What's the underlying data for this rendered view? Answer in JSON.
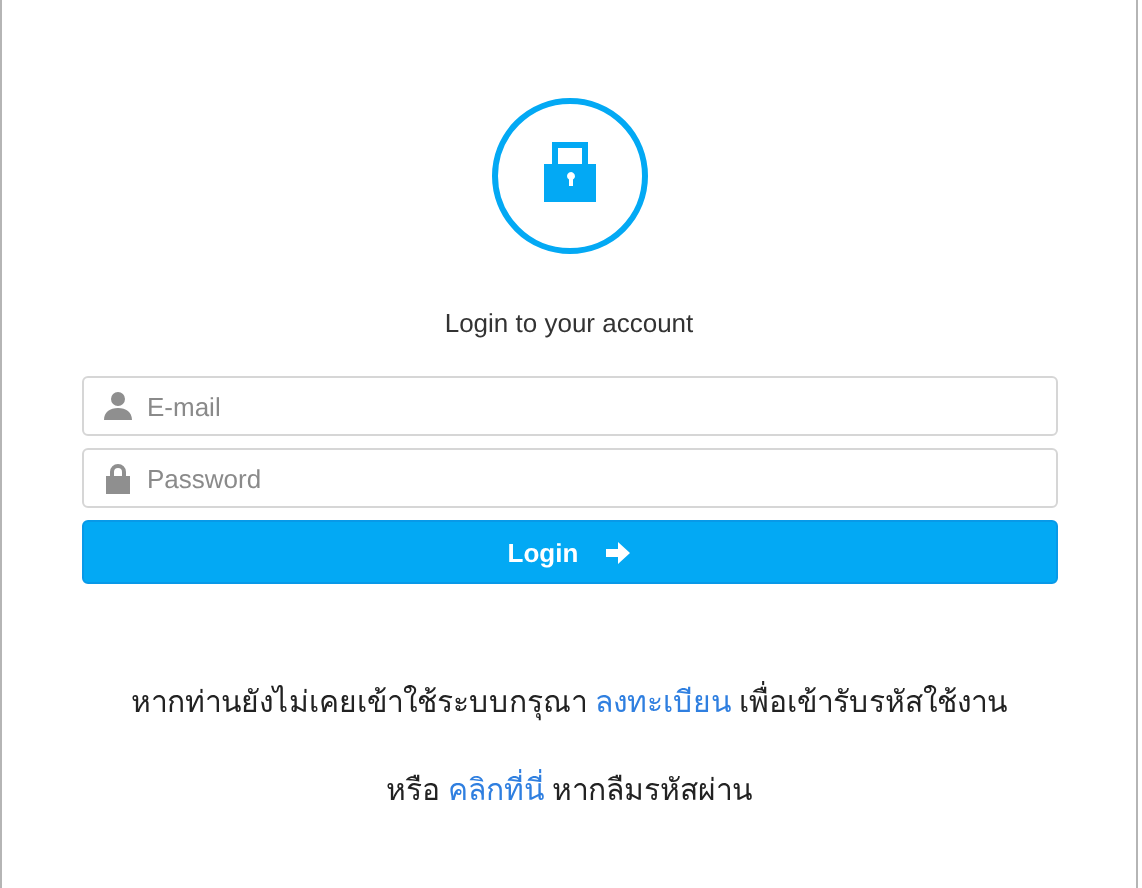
{
  "heading": "Login to your account",
  "fields": [
    {
      "kind": "email",
      "placeholder": "E-mail"
    },
    {
      "kind": "password",
      "placeholder": "Password"
    }
  ],
  "login_button": {
    "label": "Login"
  },
  "register_line": {
    "before": "หากท่านยังไม่เคยเข้าใช้ระบบกรุณา",
    "link": "ลงทะเบียน",
    "after": "เพื่อเข้ารับรหัสใช้งาน"
  },
  "forgot_line": {
    "before": "หรือ",
    "link": "คลิกที่นี่",
    "after": "หากลืมรหัสผ่าน"
  }
}
